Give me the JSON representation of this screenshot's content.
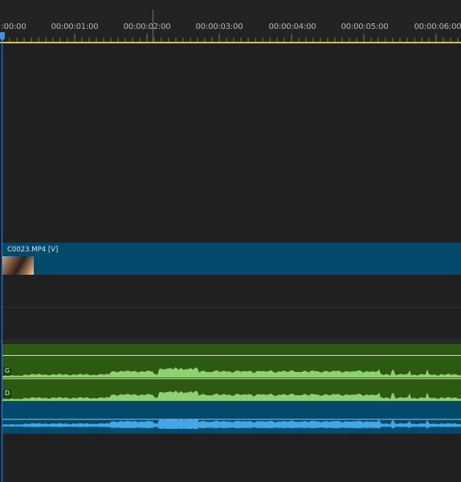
{
  "ruler": {
    "timecodes": [
      ":00:00",
      "00:00:01:00",
      "00:00:02:00",
      "00:00:03:00",
      "00:00:04:00",
      "00:00:05:00",
      "00:00:06:00"
    ]
  },
  "video_clip": {
    "label": "C0023.MP4 [V]"
  },
  "audio_clip": {
    "channel_left": "G",
    "channel_right": "D"
  },
  "colors": {
    "video_clip": "#024a6b",
    "audio_clip_stereo": "#2b5a10",
    "audio_waveform": "#8fd070",
    "audio_clip_mono": "#024a6b",
    "mono_waveform": "#3fa8e8",
    "playhead": "#2f7fd8",
    "work_area_bar": "#d8c81a"
  }
}
